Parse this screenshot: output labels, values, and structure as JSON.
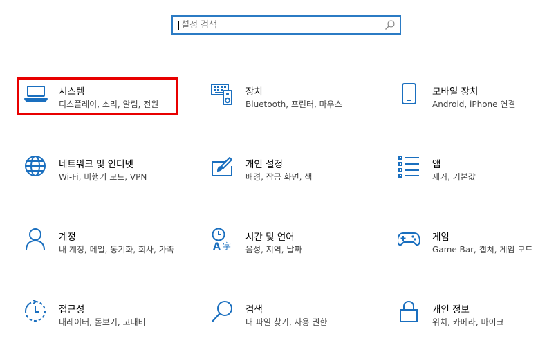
{
  "search": {
    "placeholder": "설정 검색"
  },
  "accent_color": "#1a6fbf",
  "highlight_color": "#e80000",
  "tiles": [
    {
      "title": "시스템",
      "desc": "디스플레이, 소리, 알림, 전원",
      "icon": "laptop-icon"
    },
    {
      "title": "장치",
      "desc": "Bluetooth, 프린터, 마우스",
      "icon": "devices-icon"
    },
    {
      "title": "모바일 장치",
      "desc": "Android, iPhone 연결",
      "icon": "phone-icon"
    },
    {
      "title": "네트워크 및 인터넷",
      "desc": "Wi-Fi, 비행기 모드, VPN",
      "icon": "globe-icon"
    },
    {
      "title": "개인 설정",
      "desc": "배경, 잠금 화면, 색",
      "icon": "paintbrush-icon"
    },
    {
      "title": "앱",
      "desc": "제거, 기본값",
      "icon": "apps-list-icon"
    },
    {
      "title": "계정",
      "desc": "내 계정, 메일, 동기화, 회사, 가족",
      "icon": "person-icon"
    },
    {
      "title": "시간 및 언어",
      "desc": "음성, 지역, 날짜",
      "icon": "time-language-icon"
    },
    {
      "title": "게임",
      "desc": "Game Bar, 캡처, 게임 모드",
      "icon": "gamepad-icon"
    },
    {
      "title": "접근성",
      "desc": "내레이터, 돋보기, 고대비",
      "icon": "accessibility-icon"
    },
    {
      "title": "검색",
      "desc": "내 파일 찾기, 사용 권한",
      "icon": "magnifier-icon"
    },
    {
      "title": "개인 정보",
      "desc": "위치, 카메라, 마이크",
      "icon": "lock-icon"
    }
  ]
}
